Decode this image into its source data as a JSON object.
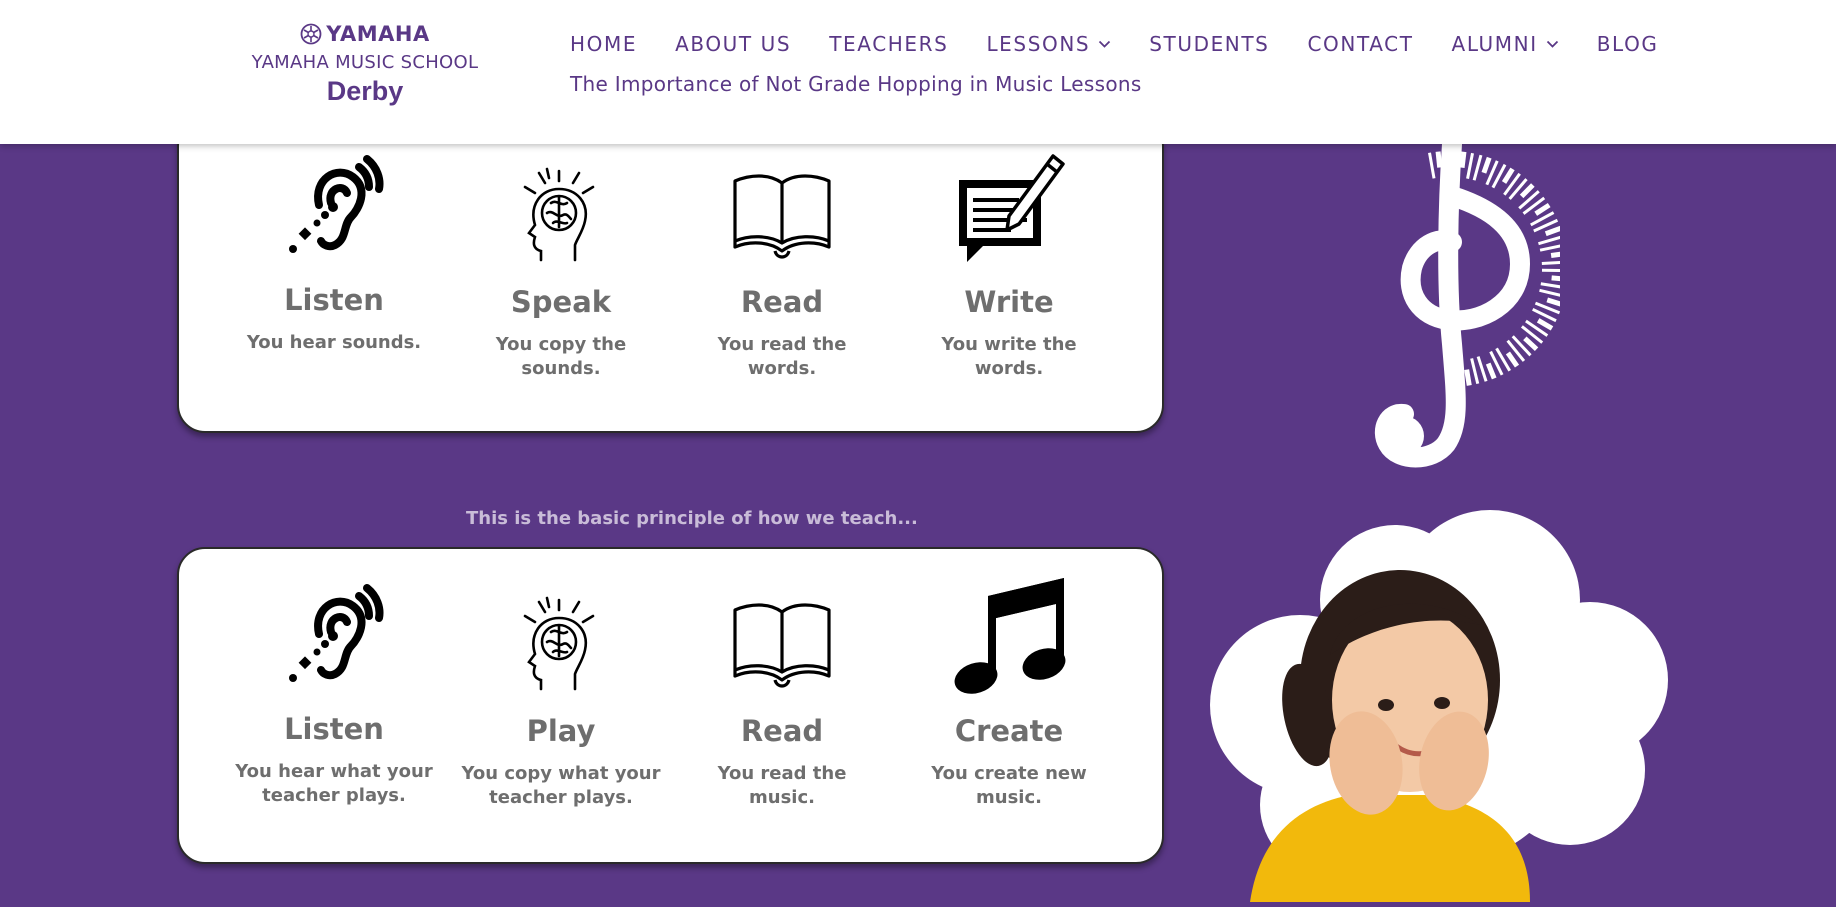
{
  "header": {
    "logo": {
      "brand": "YAMAHA",
      "school": "YAMAHA MUSIC SCHOOL",
      "city": "Derby"
    },
    "nav": [
      {
        "label": "HOME",
        "dropdown": false
      },
      {
        "label": "ABOUT US",
        "dropdown": false
      },
      {
        "label": "TEACHERS",
        "dropdown": false
      },
      {
        "label": "LESSONS",
        "dropdown": true
      },
      {
        "label": "STUDENTS",
        "dropdown": false
      },
      {
        "label": "CONTACT",
        "dropdown": false
      },
      {
        "label": "ALUMNI",
        "dropdown": true
      },
      {
        "label": "BLOG",
        "dropdown": false
      }
    ],
    "current_page": "The Importance of Not Grade Hopping in Music Lessons"
  },
  "language_card": {
    "items": [
      {
        "title": "Listen",
        "desc": "You hear sounds.",
        "icon": "ear-icon"
      },
      {
        "title": "Speak",
        "desc": "You copy the sounds.",
        "icon": "head-brain-icon"
      },
      {
        "title": "Read",
        "desc": "You read the words.",
        "icon": "open-book-icon"
      },
      {
        "title": "Write",
        "desc": "You write the words.",
        "icon": "write-speech-bubble-icon"
      }
    ]
  },
  "principle_text": "This is the basic principle of how we teach...",
  "music_card": {
    "items": [
      {
        "title": "Listen",
        "desc": "You hear what your teacher plays.",
        "icon": "ear-icon"
      },
      {
        "title": "Play",
        "desc": "You copy what your teacher plays.",
        "icon": "head-brain-icon"
      },
      {
        "title": "Read",
        "desc": "You read the music.",
        "icon": "open-book-icon"
      },
      {
        "title": "Create",
        "desc": "You create new music.",
        "icon": "music-note-icon"
      }
    ]
  },
  "colors": {
    "brand_purple": "#5a3886",
    "text_gray": "#6e6e6e",
    "background": "#5a3886"
  }
}
